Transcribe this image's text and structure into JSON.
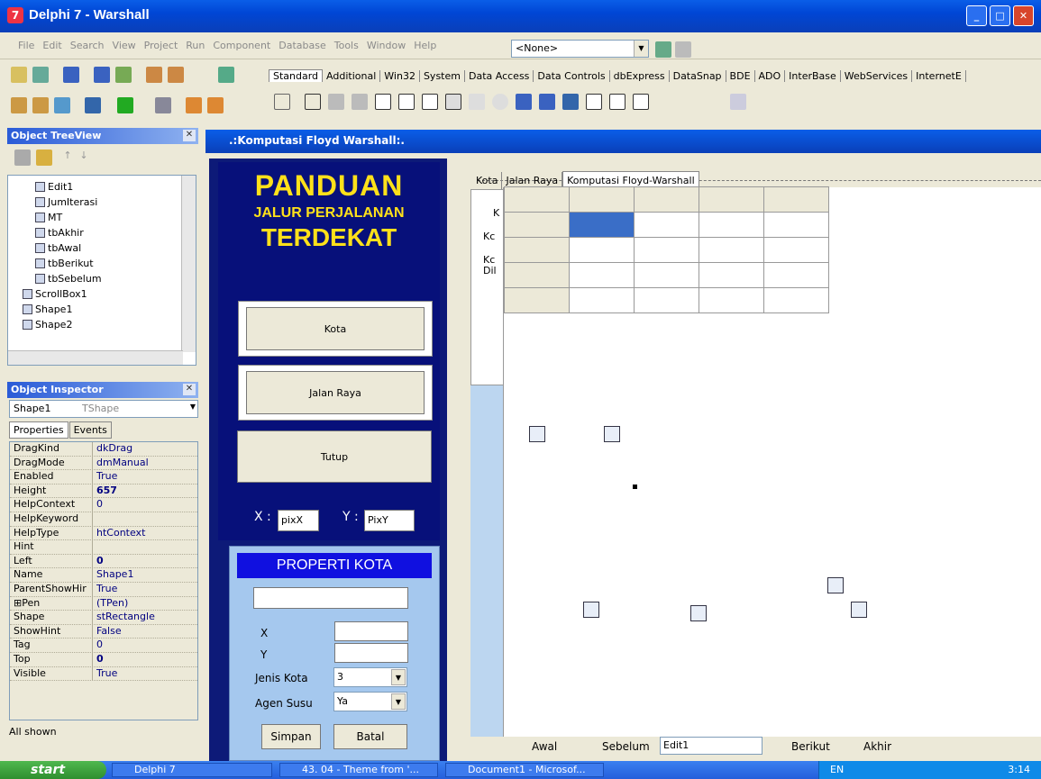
{
  "window": {
    "title": "Delphi 7 - Warshall"
  },
  "menu": [
    "File",
    "Edit",
    "Search",
    "View",
    "Project",
    "Run",
    "Component",
    "Database",
    "Tools",
    "Window",
    "Help"
  ],
  "combo_none": "<None>",
  "palette_tabs": [
    "Standard",
    "Additional",
    "Win32",
    "System",
    "Data Access",
    "Data Controls",
    "dbExpress",
    "DataSnap",
    "BDE",
    "ADO",
    "InterBase",
    "WebServices",
    "InternetE"
  ],
  "treeview": {
    "title": "Object TreeView",
    "items": [
      "Edit1",
      "JumIterasi",
      "MT",
      "tbAkhir",
      "tbAwal",
      "tbBerikut",
      "tbSebelum",
      "ScrollBox1",
      "Shape1",
      "Shape2"
    ]
  },
  "inspector": {
    "title": "Object Inspector",
    "selected": "Shape1",
    "selected_type": "TShape",
    "tabs": [
      "Properties",
      "Events"
    ],
    "props": [
      {
        "k": "DragKind",
        "v": "dkDrag"
      },
      {
        "k": "DragMode",
        "v": "dmManual"
      },
      {
        "k": "Enabled",
        "v": "True"
      },
      {
        "k": "Height",
        "v": "657"
      },
      {
        "k": "HelpContext",
        "v": "0"
      },
      {
        "k": "HelpKeyword",
        "v": ""
      },
      {
        "k": "HelpType",
        "v": "htContext"
      },
      {
        "k": "Hint",
        "v": ""
      },
      {
        "k": "Left",
        "v": "0"
      },
      {
        "k": "Name",
        "v": "Shape1"
      },
      {
        "k": "ParentShowHir",
        "v": "True"
      },
      {
        "k": "⊞Pen",
        "v": "(TPen)"
      },
      {
        "k": "Shape",
        "v": "stRectangle"
      },
      {
        "k": "ShowHint",
        "v": "False"
      },
      {
        "k": "Tag",
        "v": "0"
      },
      {
        "k": "Top",
        "v": "0"
      },
      {
        "k": "Visible",
        "v": "True"
      }
    ],
    "status": "All shown"
  },
  "form": {
    "title": ".:Komputasi Floyd Warshall:.",
    "logo_line1": "PANDUAN",
    "logo_line2": "JALUR PERJALANAN",
    "logo_line3": "TERDEKAT",
    "btn_kota": "Kota",
    "btn_jalan": "Jalan Raya",
    "btn_tutup": "Tutup",
    "x_label": "X :",
    "x_value": "pixX",
    "y_label": "Y :",
    "y_value": "PixY",
    "prop_title": "PROPERTI KOTA",
    "lbl_x": "X",
    "lbl_y": "Y",
    "lbl_jenis": "Jenis Kota",
    "jenis_value": "3",
    "lbl_agen": "Agen Susu",
    "agen_value": "Ya",
    "btn_simpan": "Simpan",
    "btn_batal": "Batal",
    "right_tabs": [
      "Kota",
      "Jalan Raya",
      "Komputasi Floyd-Warshall"
    ],
    "side_labels": [
      "K",
      "Kc",
      "Kc",
      "Dil"
    ],
    "nav_awal": "Awal",
    "nav_sebelum": "Sebelum",
    "nav_edit": "Edit1",
    "nav_berikut": "Berikut",
    "nav_akhir": "Akhir"
  },
  "taskbar": {
    "start": "start",
    "tasks": [
      "Delphi 7",
      "43. 04 - Theme from '...",
      "Document1 - Microsof..."
    ],
    "lang": "EN",
    "time": "3:14"
  }
}
